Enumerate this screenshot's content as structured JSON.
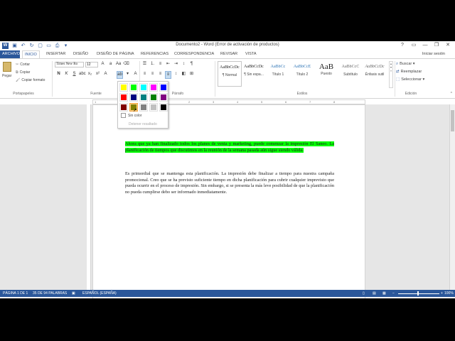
{
  "window": {
    "title": "Documento2 - Word (Error de activación de productos)",
    "app_icon": "W",
    "controls": [
      "?",
      "▭",
      "—",
      "❐",
      "✕"
    ]
  },
  "qat": [
    "save-icon",
    "undo-icon",
    "redo-icon",
    "new-icon",
    "open-icon",
    "print-icon",
    "customize-icon"
  ],
  "tabs": {
    "file": "ARCHIVO",
    "items": [
      "INICIO",
      "INSERTAR",
      "DISEÑO",
      "DISEÑO DE PÁGINA",
      "REFERENCIAS",
      "CORRESPONDENCIA",
      "REVISAR",
      "VISTA"
    ],
    "active": "INICIO",
    "signin": "Iniciar sesión"
  },
  "ribbon": {
    "clipboard": {
      "paste": "Pegar",
      "cut": "Cortar",
      "copy": "Copiar",
      "format_painter": "Copiar formato",
      "label": "Portapapeles"
    },
    "font": {
      "family": "Times New Ro",
      "size": "12",
      "label": "Fuente"
    },
    "paragraph": {
      "label": "Párrafo"
    },
    "styles": {
      "label": "Estilos",
      "items": [
        {
          "preview": "AaBbCcDc",
          "name": "¶ Normal"
        },
        {
          "preview": "AaBbCcDc",
          "name": "¶ Sin espa..."
        },
        {
          "preview": "AaBbCc",
          "name": "Título 1"
        },
        {
          "preview": "AaBbCcE",
          "name": "Título 2"
        },
        {
          "preview": "AaB",
          "name": "Puesto"
        },
        {
          "preview": "AaBbCcC",
          "name": "Subtítulo"
        },
        {
          "preview": "AaBbCcDc",
          "name": "Énfasis sutil"
        }
      ]
    },
    "editing": {
      "find": "Buscar",
      "replace": "Reemplazar",
      "select": "Seleccionar",
      "label": "Edición"
    }
  },
  "highlight_menu": {
    "colors": [
      "#ffff00",
      "#00ff00",
      "#00ffff",
      "#ff00ff",
      "#0000ff",
      "#ff0000",
      "#000080",
      "#008080",
      "#008000",
      "#800080",
      "#800000",
      "#808000",
      "#808080",
      "#c0c0c0",
      "#000000"
    ],
    "selected_index": 11,
    "no_color": "Sin color",
    "stop_highlighting": "Detener resaltado"
  },
  "document": {
    "paragraph1_highlighted": "Ahora que ya han finalizado todos los planes de venta y marketing, puede comenzar la impresión El Saneo. La planificación de tiempos que discutimos en la reunión de la semana pasada aún sigue siendo válida.",
    "paragraph2": "Es primordial que se mantenga esta planificación. La impresión debe finalizar a tiempo para nuestra campaña promocional. Creo que se ha previsto suficiente tiempo en dicha planificación para cubrir cualquier imprevisto que pueda ocurrir en el proceso de impresión. Sin embargo, si se presenta la más leve posibilidad de que la planificación no pueda cumplirse debo ser informado inmediatamente."
  },
  "statusbar": {
    "page": "PÁGINA 1 DE 1",
    "words": "35 DE 94 PALABRAS",
    "language": "ESPAÑOL (ESPAÑA)",
    "zoom": "100%"
  },
  "colors": {
    "accent": "#2b579a",
    "highlight": "#00ff00"
  }
}
